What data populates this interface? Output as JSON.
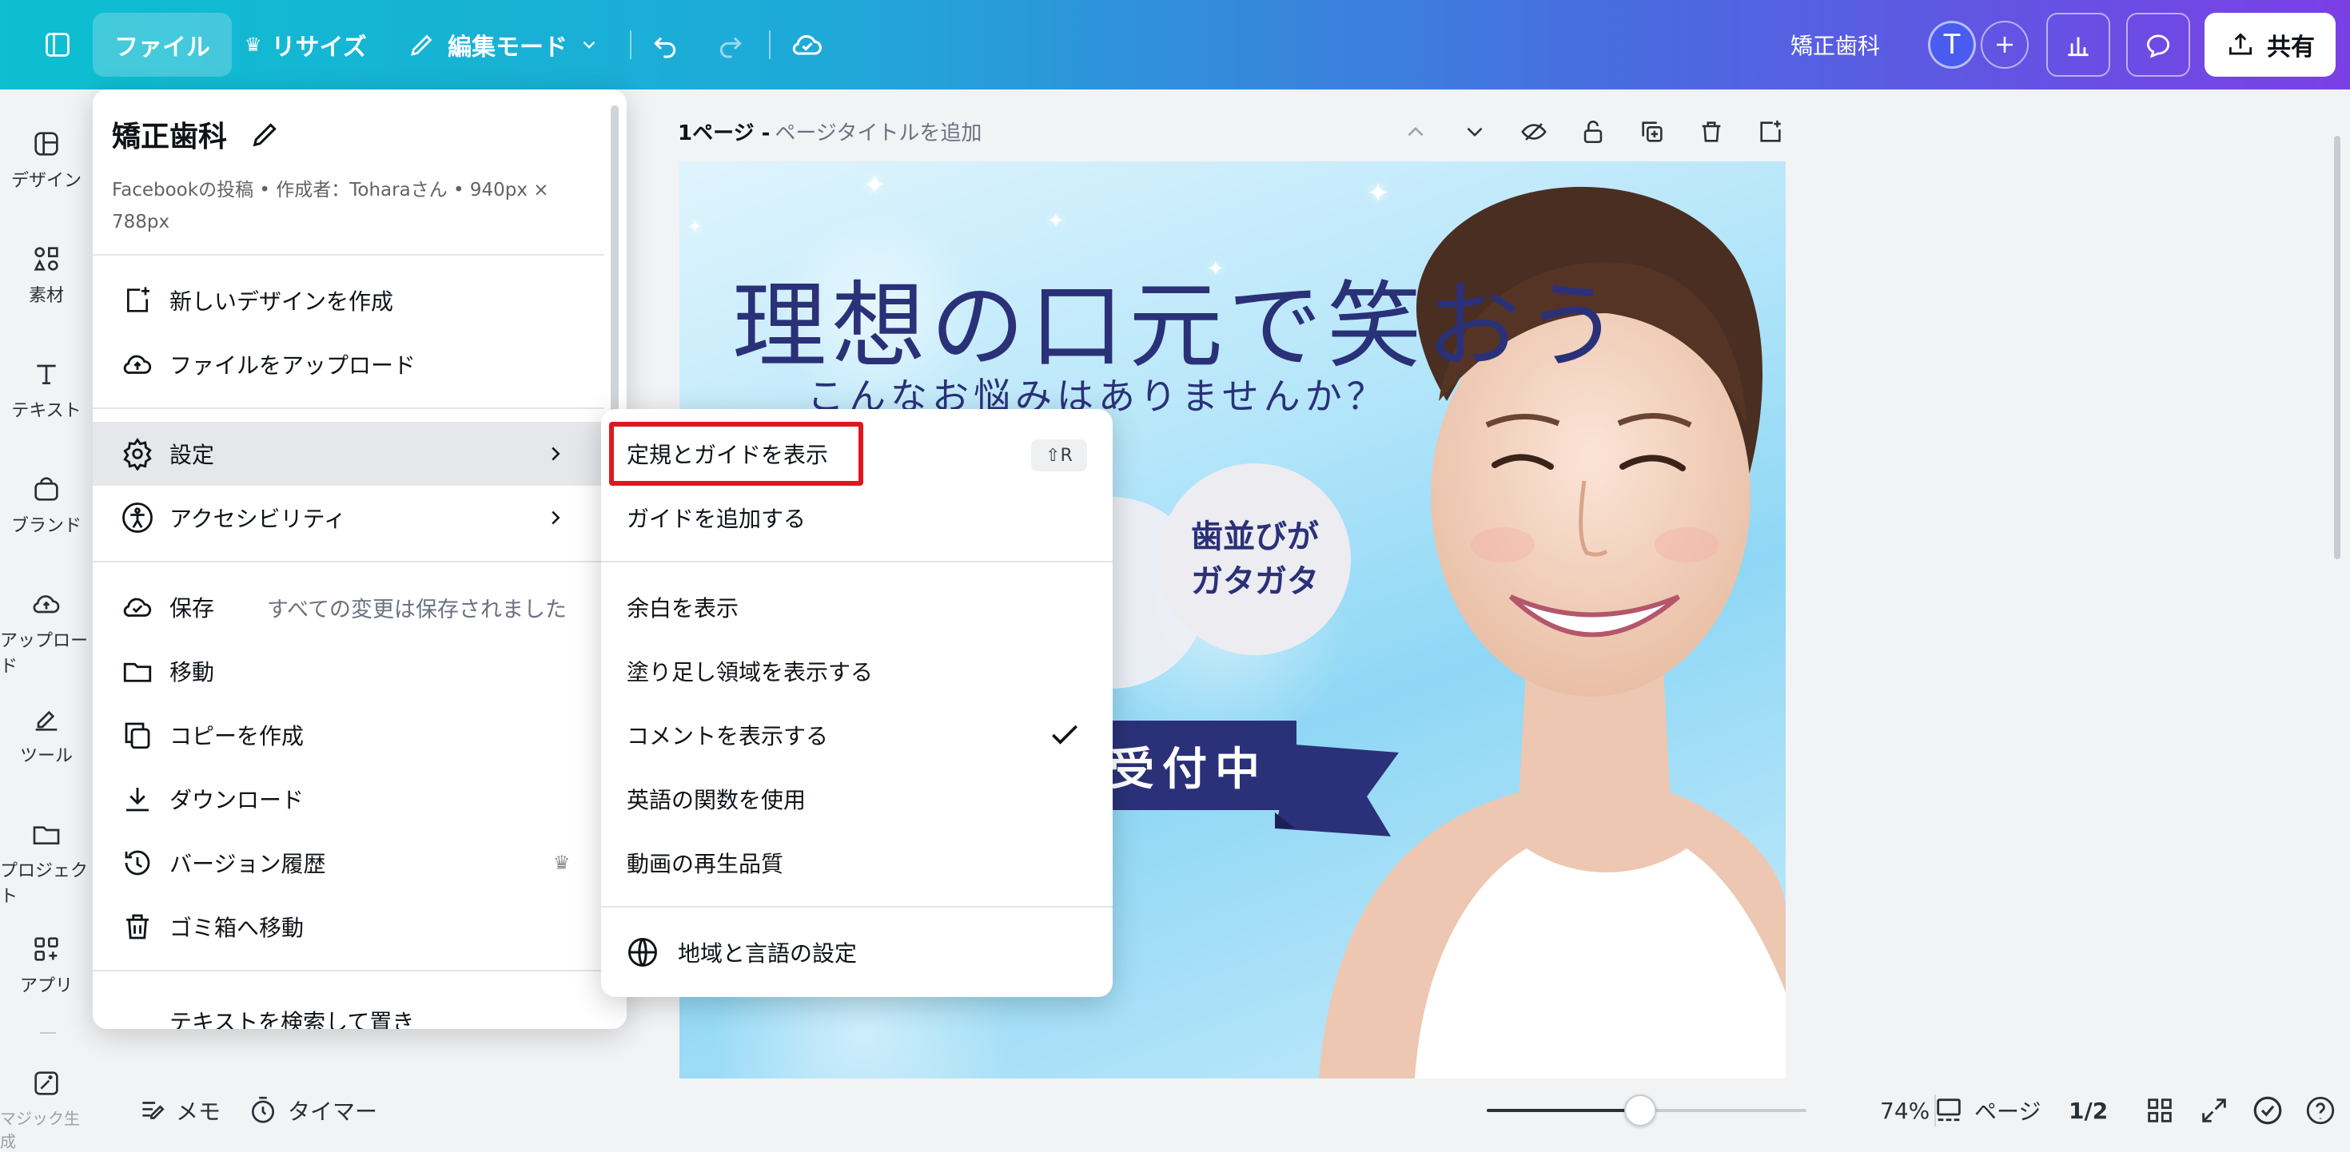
{
  "topbar": {
    "file": "ファイル",
    "resize": "リサイズ",
    "edit_mode": "編集モード",
    "doc_title": "矯正歯科",
    "avatar_initial": "T",
    "share": "共有"
  },
  "rail": {
    "items": [
      {
        "label": "デザイン",
        "icon": "layout-icon"
      },
      {
        "label": "素材",
        "icon": "elements-icon"
      },
      {
        "label": "テキスト",
        "icon": "text-icon"
      },
      {
        "label": "ブランド",
        "icon": "brand-icon"
      },
      {
        "label": "アップロード",
        "icon": "upload-icon"
      },
      {
        "label": "ツール",
        "icon": "draw-icon"
      },
      {
        "label": "プロジェクト",
        "icon": "folder-icon"
      },
      {
        "label": "アプリ",
        "icon": "apps-icon"
      },
      {
        "label": "マジック生成",
        "icon": "magic-icon"
      }
    ]
  },
  "file_menu": {
    "title": "矯正歯科",
    "meta_line1": "Facebookの投稿 • 作成者：Toharaさん • 940px ×",
    "meta_line2": "788px",
    "items": {
      "new_design": "新しいデザインを作成",
      "upload": "ファイルをアップロード",
      "settings": "設定",
      "accessibility": "アクセシビリティ",
      "save": "保存",
      "save_status": "すべての変更は保存されました",
      "move": "移動",
      "copy": "コピーを作成",
      "download": "ダウンロード",
      "version_history": "バージョン履歴",
      "trash": "ゴミ箱へ移動",
      "find_replace": "テキストを検索して置き"
    }
  },
  "settings_submenu": {
    "show_rulers": "定規とガイドを表示",
    "show_rulers_shortcut": "⇧R",
    "add_guides": "ガイドを追加する",
    "show_margins": "余白を表示",
    "show_bleed": "塗り足し領域を表示する",
    "show_comments": "コメントを表示する",
    "english_functions": "英語の関数を使用",
    "video_quality": "動画の再生品質",
    "region_language": "地域と言語の設定"
  },
  "page": {
    "label": "1ページ - ",
    "title_placeholder": "ページタイトルを追加"
  },
  "design": {
    "headline": "理想の口元で笑おう",
    "subheadline": "こんなお悩みはありませんか？",
    "bubble_line1": "歯並びが",
    "bubble_line2": "ガタガタ",
    "ribbon": "受付中"
  },
  "bottombar": {
    "notes": "メモ",
    "timer": "タイマー",
    "zoom": "74%",
    "zoom_fraction": 0.48,
    "pages": "ページ",
    "page_count": "1/2"
  },
  "colors": {
    "highlight": "#e0161e",
    "brand_navy": "#2a3178"
  }
}
